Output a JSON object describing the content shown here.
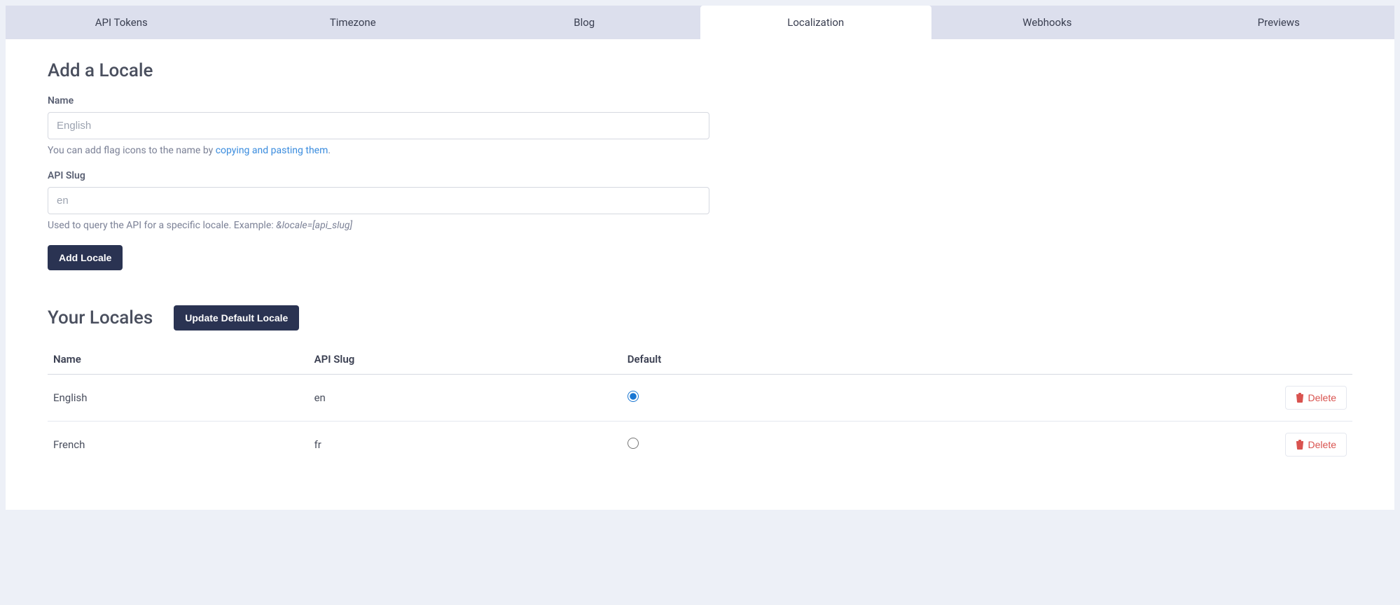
{
  "tabs": [
    {
      "label": "API Tokens",
      "active": false
    },
    {
      "label": "Timezone",
      "active": false
    },
    {
      "label": "Blog",
      "active": false
    },
    {
      "label": "Localization",
      "active": true
    },
    {
      "label": "Webhooks",
      "active": false
    },
    {
      "label": "Previews",
      "active": false
    }
  ],
  "add_locale": {
    "title": "Add a Locale",
    "name_label": "Name",
    "name_placeholder": "English",
    "name_hint_prefix": "You can add flag icons to the name by ",
    "name_hint_link": "copying and pasting them",
    "name_hint_suffix": ".",
    "slug_label": "API Slug",
    "slug_placeholder": "en",
    "slug_hint_prefix": "Used to query the API for a specific locale. Example: ",
    "slug_hint_example": "&locale=[api_slug]",
    "submit_label": "Add Locale"
  },
  "your_locales": {
    "title": "Your Locales",
    "update_button": "Update Default Locale",
    "columns": {
      "name": "Name",
      "slug": "API Slug",
      "default": "Default"
    },
    "delete_label": "Delete",
    "rows": [
      {
        "name": "English",
        "slug": "en",
        "default": true
      },
      {
        "name": "French",
        "slug": "fr",
        "default": false
      }
    ]
  }
}
